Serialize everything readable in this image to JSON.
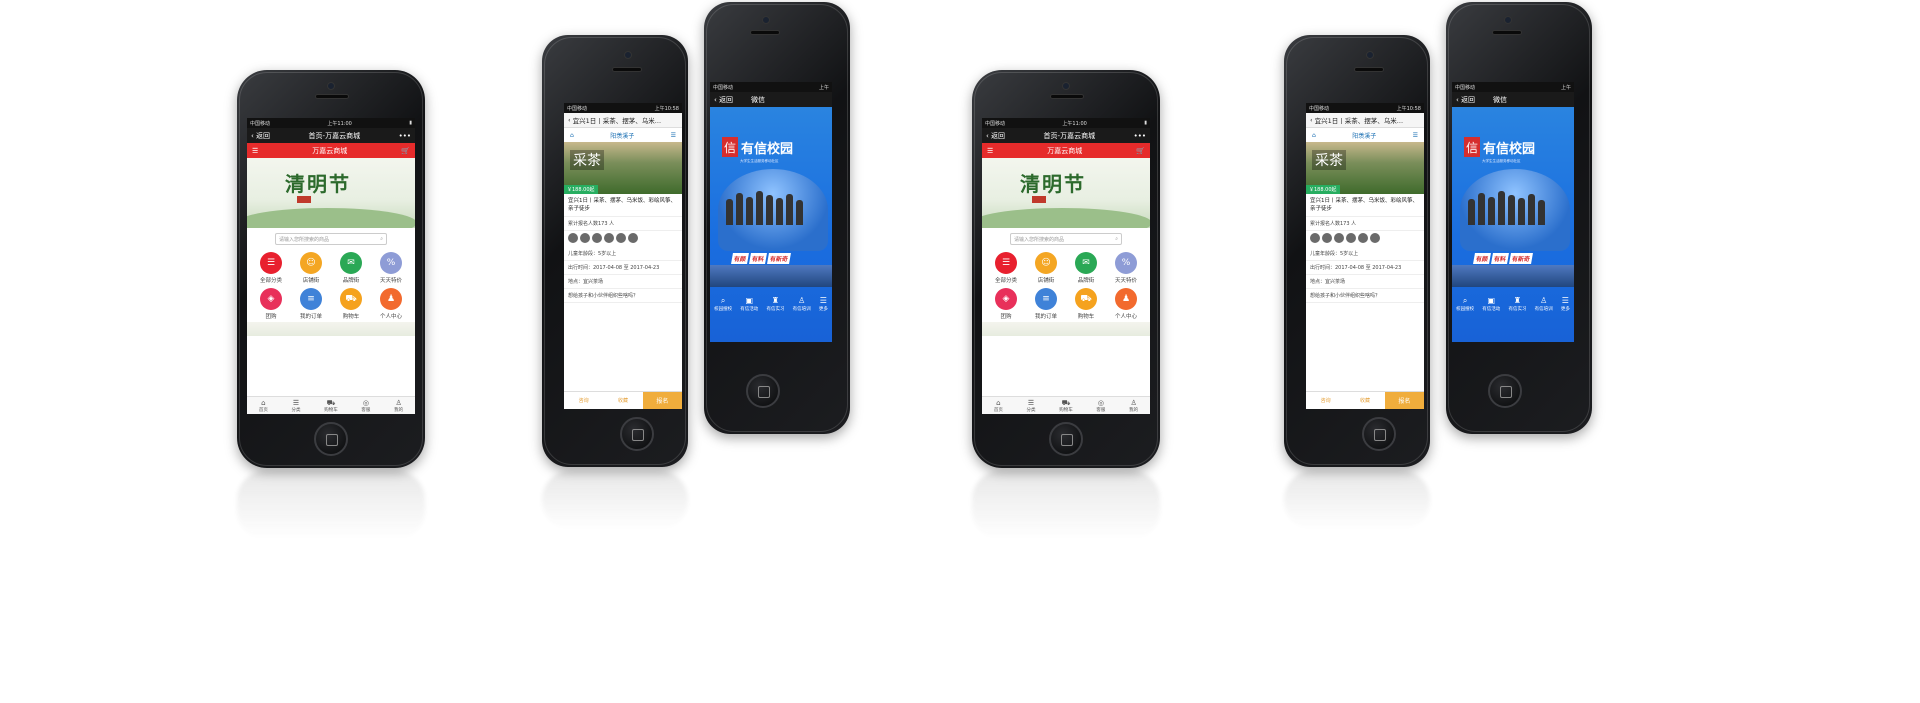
{
  "shop_screen": {
    "carrier": "中国移动",
    "time": "上午11:00",
    "back_label": "返回",
    "title": "首页-万嘉云商城",
    "more": "•••",
    "app_name": "万嘉云商城",
    "banner_text": "清明节",
    "search_placeholder": "请输入您所搜索的商品",
    "icons": [
      {
        "label": "全部分类",
        "color": "#e8202e",
        "glyph": "☰"
      },
      {
        "label": "店铺街",
        "color": "#f4a623",
        "glyph": "☺"
      },
      {
        "label": "品牌街",
        "color": "#2aa855",
        "glyph": "✉"
      },
      {
        "label": "天天特价",
        "color": "#8e9cd6",
        "glyph": "%"
      },
      {
        "label": "团购",
        "color": "#e8305a",
        "glyph": "◈"
      },
      {
        "label": "我的订单",
        "color": "#3f82d8",
        "glyph": "≡"
      },
      {
        "label": "购物车",
        "color": "#f5a21e",
        "glyph": "🛒"
      },
      {
        "label": "个人中心",
        "color": "#f26a2e",
        "glyph": "♟"
      }
    ],
    "back_top": "顶部",
    "tabs": [
      "首页",
      "分类",
      "购物车",
      "客服",
      "我的"
    ]
  },
  "tea_screen": {
    "carrier": "中国移动",
    "time": "上午10:58",
    "back_label": "返回",
    "nav_title": "宜兴1日丨采茶、摆茅、乌米...",
    "logo": "阳羡溪子",
    "banner_text": "采茶",
    "price": "￥188.00起",
    "title": "宜兴1日丨采茶、摆茅、乌米饭、彩绘风筝、亲子徒步",
    "signups": "累计报名人数173 人",
    "age": "儿童年龄段：5岁以上",
    "date": "出行时间：2017-04-08 至 2017-04-23",
    "place": "地点：宜兴茶场",
    "question": "想给孩子和小伙伴组织些啥吗？",
    "btn_contact": "咨询",
    "btn_fav": "收藏",
    "btn_signup": "报名"
  },
  "campus_screen": {
    "carrier": "中国移动",
    "time": "上午",
    "back_label": "返回",
    "title": "微信",
    "seal": "信",
    "name": "有信校园",
    "subtitle": "大学生生活服务移动社区",
    "slogans": [
      "有颜",
      "有料",
      "有新奇"
    ],
    "menu": [
      {
        "label": "校园搜校",
        "glyph": "⌕"
      },
      {
        "label": "有信活动",
        "glyph": "▣"
      },
      {
        "label": "有信实习",
        "glyph": "♜"
      },
      {
        "label": "有信培训",
        "glyph": "♙"
      },
      {
        "label": "更多",
        "glyph": "☰"
      }
    ]
  },
  "colors": {
    "accent_red": "#e62b2b",
    "campus_blue": "#1a6ee0",
    "signup_orange": "#f0ad3c"
  }
}
